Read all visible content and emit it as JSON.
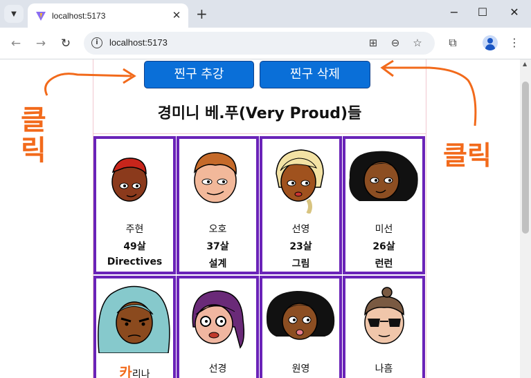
{
  "browser": {
    "tab_title": "localhost:5173",
    "url": "localhost:5173",
    "accent": "#0a6fd8"
  },
  "icons": {
    "tab_menu": "chevron-down-icon",
    "close": "close-icon",
    "new_tab": "plus-icon",
    "minimize": "minimize-icon",
    "maximize": "maximize-icon",
    "window_close": "close-icon",
    "back": "arrow-left-icon",
    "forward": "arrow-right-icon",
    "reload": "reload-icon",
    "translate": "translate-icon",
    "zoom": "zoom-icon",
    "bookmark": "star-icon",
    "extensions": "puzzle-icon",
    "menu": "kebab-menu-icon"
  },
  "app": {
    "add_button": "찐구 추강",
    "delete_button": "찐구 삭제",
    "heading": "경미니 베.푸(Very Proud)들",
    "card_border_color": "#6a23b8",
    "friends": [
      {
        "name": "주현",
        "age": "49살",
        "desc": "Directives"
      },
      {
        "name": "오호",
        "age": "37살",
        "desc": "설계"
      },
      {
        "name": "선영",
        "age": "23살",
        "desc": "그림"
      },
      {
        "name": "미선",
        "age": "26살",
        "desc": "런런"
      },
      {
        "name_prefix": "카",
        "name": "리나"
      },
      {
        "name": "선경"
      },
      {
        "name": "원영"
      },
      {
        "name": "나흠"
      }
    ]
  },
  "annotations": {
    "left_text": "클릭",
    "right_text": "클릭",
    "color": "#f26a1b"
  }
}
